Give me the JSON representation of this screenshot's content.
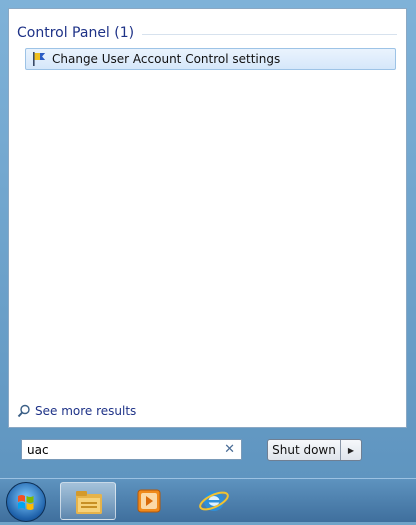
{
  "search_results": {
    "group_title": "Control Panel (1)",
    "items": [
      {
        "label": "Change User Account Control settings",
        "icon": "uac-flag-icon"
      }
    ],
    "see_more_label": "See more results"
  },
  "search": {
    "value": "uac",
    "clear_icon": "close-icon"
  },
  "power": {
    "shutdown_label": "Shut down",
    "arrow_glyph": "▶"
  },
  "taskbar": {
    "items": [
      {
        "name": "start-orb-icon"
      },
      {
        "name": "windows-explorer-icon",
        "active": true
      },
      {
        "name": "media-player-icon"
      },
      {
        "name": "internet-explorer-icon"
      }
    ]
  },
  "colors": {
    "header_text": "#1e3287",
    "selection_border": "#9dc3e6",
    "frame": "#6fa3c8"
  }
}
